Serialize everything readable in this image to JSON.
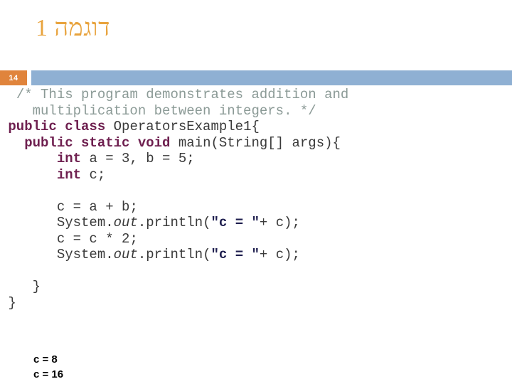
{
  "slide": {
    "title": "דוגמה 1",
    "page_number": "14",
    "accent_orange": "#E0843C",
    "title_orange": "#E8A33D",
    "band_blue": "#8FB0D3",
    "keyword_color": "#6E1F4F",
    "comment_color": "#8b9a96",
    "string_color": "#1f1f4f"
  },
  "code": {
    "language": "java",
    "lines": [
      {
        "id": "line-comment-1",
        "indent": "  ",
        "tokens": [
          {
            "type": "comment",
            "text": "/* This program demonstrates addition and"
          }
        ]
      },
      {
        "id": "line-comment-2",
        "indent": "    ",
        "tokens": [
          {
            "type": "comment",
            "text": "multiplication between integers. */"
          }
        ]
      },
      {
        "id": "line-class-decl",
        "indent": " ",
        "tokens": [
          {
            "type": "keyword",
            "text": "public class "
          },
          {
            "type": "plain",
            "text": "OperatorsExample1{"
          }
        ]
      },
      {
        "id": "line-main-decl",
        "indent": "   ",
        "tokens": [
          {
            "type": "keyword",
            "text": "public static void "
          },
          {
            "type": "plain",
            "text": "main(String[] args){"
          }
        ]
      },
      {
        "id": "line-int-ab",
        "indent": "       ",
        "tokens": [
          {
            "type": "keyword",
            "text": "int "
          },
          {
            "type": "plain",
            "text": "a = 3, b = 5;"
          }
        ]
      },
      {
        "id": "line-int-c",
        "indent": "       ",
        "tokens": [
          {
            "type": "keyword",
            "text": "int "
          },
          {
            "type": "plain",
            "text": "c;"
          }
        ]
      },
      {
        "id": "line-blank-1",
        "indent": "",
        "tokens": []
      },
      {
        "id": "line-assign-add",
        "indent": "       ",
        "tokens": [
          {
            "type": "plain",
            "text": "c = a + b;"
          }
        ]
      },
      {
        "id": "line-print-1",
        "indent": "       ",
        "tokens": [
          {
            "type": "plain",
            "text": "System."
          },
          {
            "type": "italic",
            "text": "out"
          },
          {
            "type": "plain",
            "text": ".println("
          },
          {
            "type": "string",
            "text": "\"c = \""
          },
          {
            "type": "plain",
            "text": "+ c);"
          }
        ]
      },
      {
        "id": "line-assign-mul",
        "indent": "       ",
        "tokens": [
          {
            "type": "plain",
            "text": "c = c * 2;"
          }
        ]
      },
      {
        "id": "line-print-2",
        "indent": "       ",
        "tokens": [
          {
            "type": "plain",
            "text": "System."
          },
          {
            "type": "italic",
            "text": "out"
          },
          {
            "type": "plain",
            "text": ".println("
          },
          {
            "type": "string",
            "text": "\"c = \""
          },
          {
            "type": "plain",
            "text": "+ c);"
          }
        ]
      },
      {
        "id": "line-blank-2",
        "indent": "",
        "tokens": []
      },
      {
        "id": "line-close-main",
        "indent": "    ",
        "tokens": [
          {
            "type": "plain",
            "text": "}"
          }
        ]
      },
      {
        "id": "line-close-class",
        "indent": " ",
        "tokens": [
          {
            "type": "plain",
            "text": "}"
          }
        ]
      }
    ]
  },
  "console_output": {
    "lines": [
      "c = 8",
      "c = 16"
    ]
  }
}
